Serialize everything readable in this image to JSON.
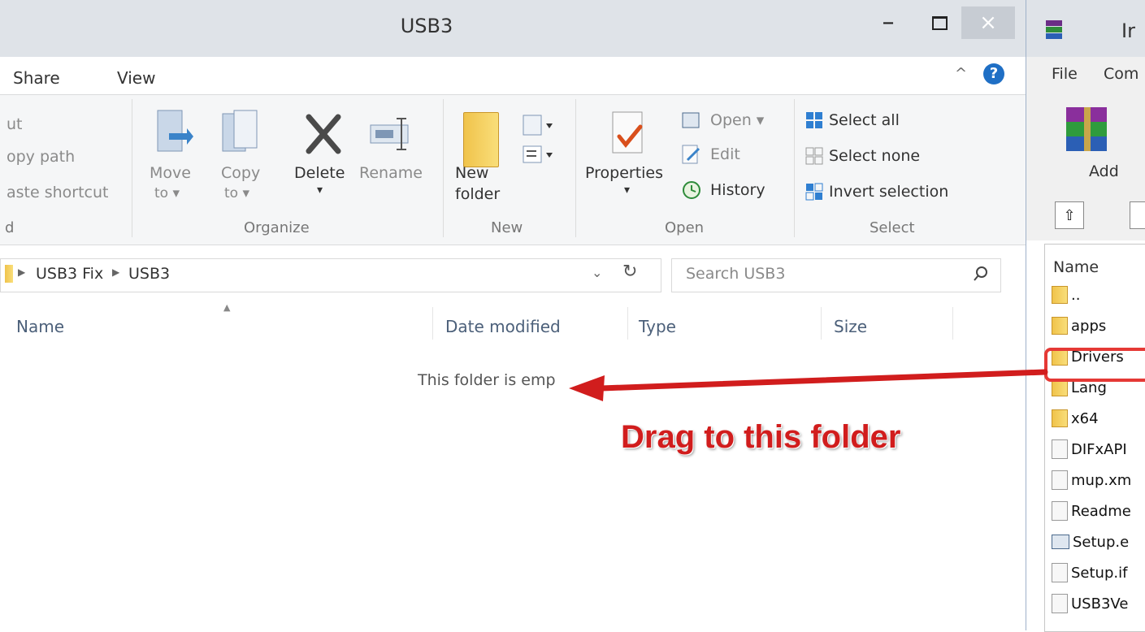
{
  "explorer": {
    "title": "USB3",
    "caption_buttons": {
      "minimize": "–",
      "close": "×"
    },
    "tabs": [
      "Share",
      "View"
    ],
    "ribbon": {
      "clipboard_partial": [
        "ut",
        "opy path",
        "aste shortcut"
      ],
      "clipboard_group_label": "d",
      "organize": {
        "move_to": [
          "Move",
          "to ▾"
        ],
        "copy_to": [
          "Copy",
          "to ▾"
        ],
        "delete": "Delete",
        "delete_arrow": "▾",
        "rename": "Rename",
        "group_label": "Organize"
      },
      "new": {
        "new_folder": [
          "New",
          "folder"
        ],
        "group_label": "New"
      },
      "open": {
        "properties": "Properties",
        "properties_arrow": "▾",
        "open": "Open ▾",
        "edit": "Edit",
        "history": "History",
        "group_label": "Open"
      },
      "select": {
        "select_all": "Select all",
        "select_none": "Select none",
        "invert_selection": "Invert selection",
        "group_label": "Select"
      }
    },
    "address": {
      "crumbs": [
        "USB3 Fix",
        "USB3"
      ],
      "search_placeholder": "Search USB3"
    },
    "columns": [
      "Name",
      "Date modified",
      "Type",
      "Size"
    ],
    "empty_message": "This folder is emp"
  },
  "winrar": {
    "title_partial": "Ir",
    "menu": [
      "File",
      "Com"
    ],
    "toolbar_add": "Add",
    "list_header": "Name",
    "items": [
      {
        "label": "..",
        "kind": "folder"
      },
      {
        "label": "apps",
        "kind": "folder"
      },
      {
        "label": "Drivers",
        "kind": "folder"
      },
      {
        "label": "Lang",
        "kind": "folder"
      },
      {
        "label": "x64",
        "kind": "folder"
      },
      {
        "label": "DIFxAPI",
        "kind": "file"
      },
      {
        "label": "mup.xm",
        "kind": "file"
      },
      {
        "label": "Readme",
        "kind": "file"
      },
      {
        "label": "Setup.e",
        "kind": "exe"
      },
      {
        "label": "Setup.if",
        "kind": "file"
      },
      {
        "label": "USB3Ve",
        "kind": "file"
      }
    ]
  },
  "annotation": {
    "text": "Drag to this folder",
    "color": "#d11d1d"
  }
}
